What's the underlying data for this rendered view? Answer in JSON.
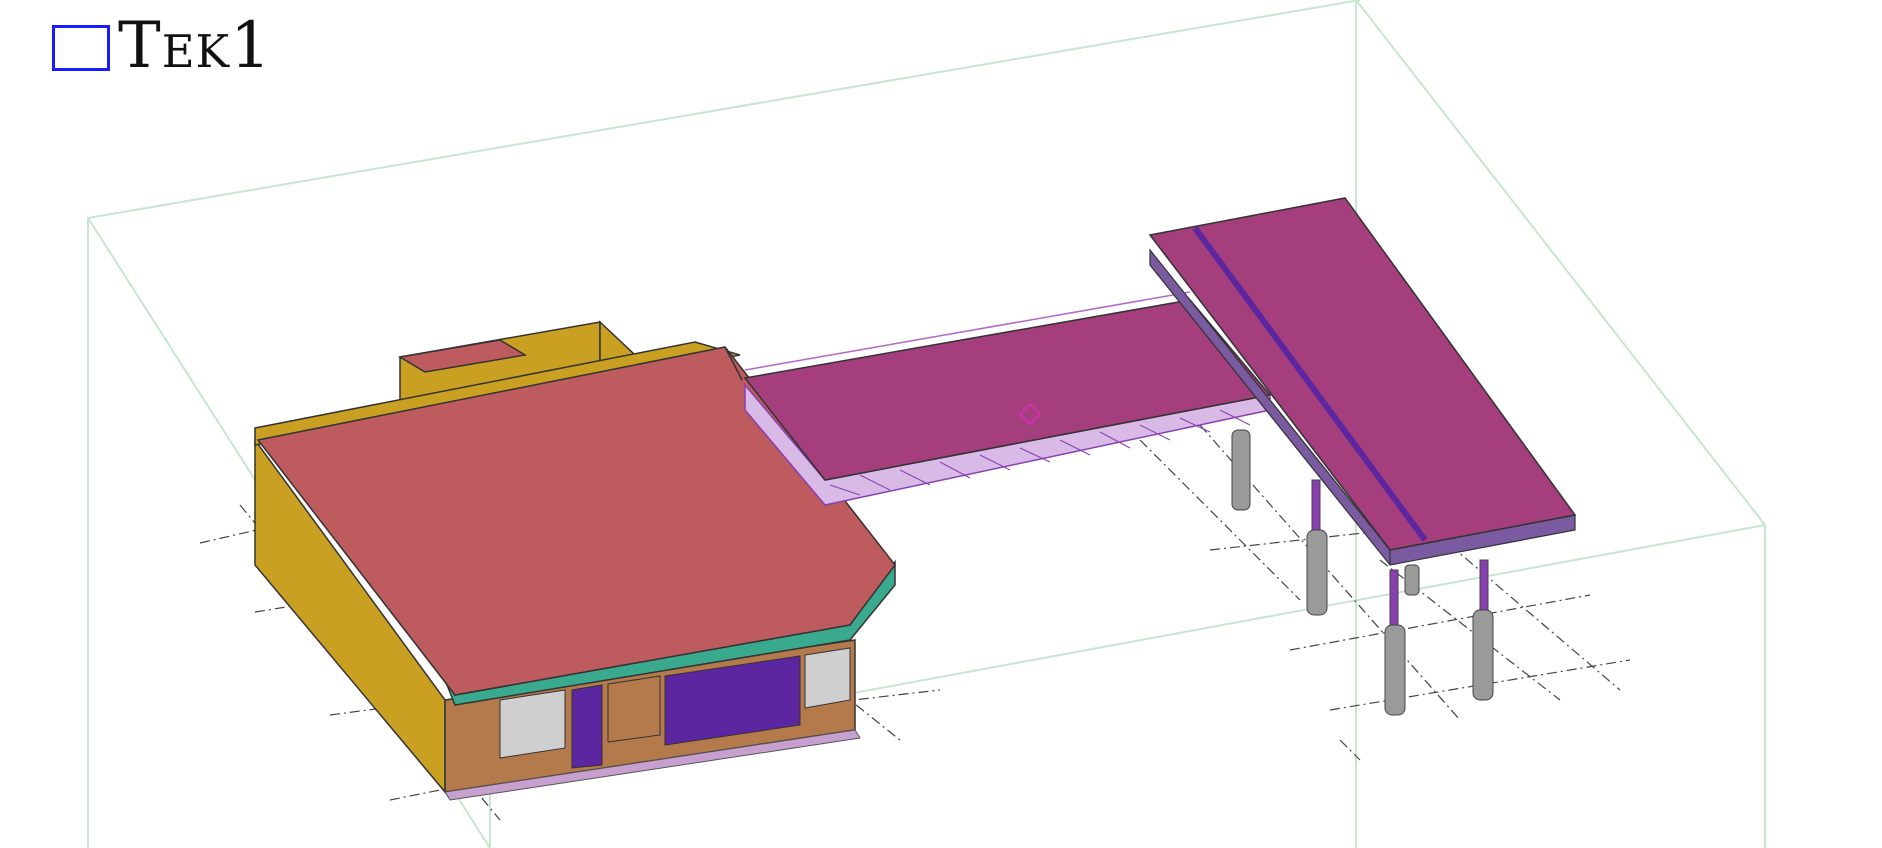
{
  "view": {
    "title": "Tek1",
    "selection_color": "#1a1aff"
  },
  "colors": {
    "bounding_box": "#c7e6cf",
    "roof": "#bd5b5f",
    "walls_yellow": "#c9a021",
    "fascia_teal": "#3aaa8f",
    "bridge_deck": "#a43e7c",
    "truss_lines": "#b267c8",
    "columns": "#9a9a9a",
    "panels_purple": "#5b26a0",
    "panels_brown": "#b47a4c",
    "grid_lines": "#333333",
    "cursor": "#d22fb3"
  },
  "icons": {
    "view_selector": "square-selection-icon",
    "cursor": "snap-cursor-icon"
  }
}
